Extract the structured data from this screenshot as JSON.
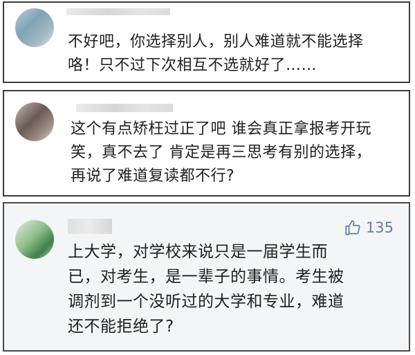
{
  "comments": [
    {
      "text": "不好吧，你选择别人，别人难道就不能选择\n咯！只不过下次相互不选就好了……"
    },
    {
      "text": "这个有点矫枉过正了吧 谁会真正拿报考开玩\n笑，真不去了 肯定是再三思考有别的选择，\n再说了难道复读都不行?"
    },
    {
      "text": "上大学，对学校来说只是一届学生而\n已，对考生，是一辈子的事情。考生被\n调剂到一个没听过的大学和专业，难道\n还不能拒绝了?",
      "likes": "135"
    }
  ],
  "icons": {
    "like": "thumbs-up-icon"
  },
  "colors": {
    "like_accent": "#5f7ea6",
    "card_border": "#3a3a3a"
  }
}
